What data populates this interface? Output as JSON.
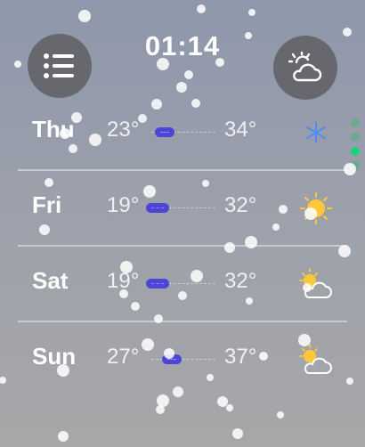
{
  "header": {
    "time": "01:14",
    "menu_icon": "list-icon",
    "weather_icon": "cloud-sun-icon"
  },
  "forecast": [
    {
      "day": "Thu",
      "low": "23°",
      "high": "34°",
      "icon": "snowflake-icon"
    },
    {
      "day": "Fri",
      "low": "19°",
      "high": "32°",
      "icon": "sun-icon"
    },
    {
      "day": "Sat",
      "low": "19°",
      "high": "32°",
      "icon": "partly-cloudy-icon"
    },
    {
      "day": "Sun",
      "low": "27°",
      "high": "37°",
      "icon": "partly-cloudy-icon"
    }
  ],
  "colors": {
    "temp_bar": "#4d45d6",
    "page_indicator_active": "#1fd07a",
    "sun": "#ffc83a",
    "snowflake": "#4d8cff"
  }
}
